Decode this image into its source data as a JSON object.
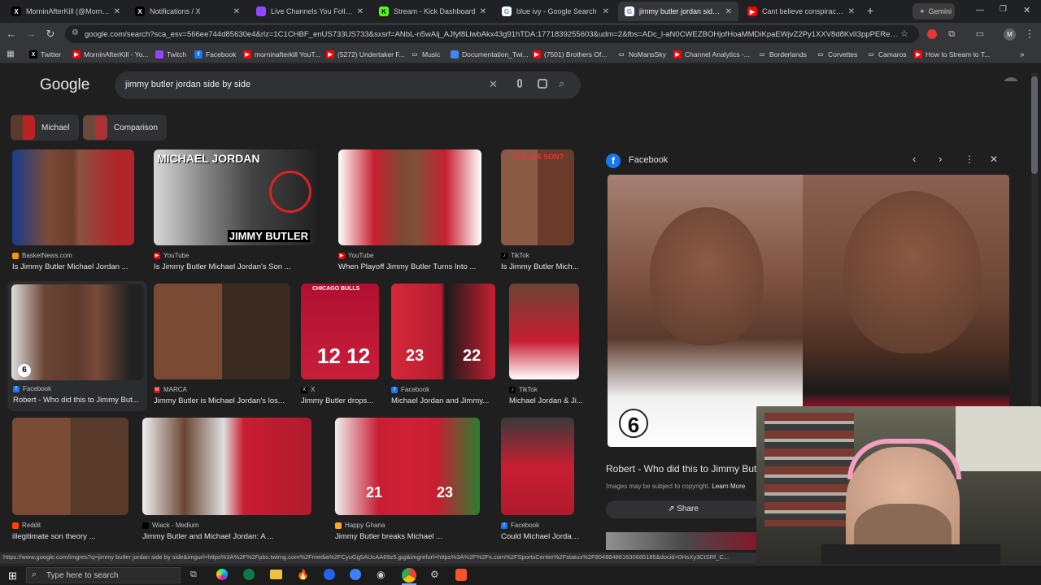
{
  "tabs": [
    {
      "label": "MorninAfterKill (@MorninAft...",
      "active": false
    },
    {
      "label": "Notifications / X",
      "active": false
    },
    {
      "label": "Live Channels You Follow - Tw",
      "active": false
    },
    {
      "label": "Stream - Kick Dashboard",
      "active": false
    },
    {
      "label": "blue ivy - Google Search",
      "active": false
    },
    {
      "label": "jimmy butler jordan side by s",
      "active": true
    },
    {
      "label": "Cant believe conspiracy Bill h",
      "active": false
    },
    {
      "label": "Gemini",
      "active": false
    }
  ],
  "new_tab_label": "+",
  "address": "google.com/search?sca_esv=566ee744d85630e4&rlz=1C1CHBF_enUS733US733&sxsrf=ANbL-n5wAlj_AJfyf8LlwbAkx43g91hTDA:1771839255603&udm=2&fbs=ADc_l-aN0CWEZBOHjofHoaMMDiKpaEWjvZ2Py1XXV8d8KvlI3ppPEReeCOS7s1V...",
  "bookmarks": [
    {
      "label": "Twitter",
      "icon": "x-icon"
    },
    {
      "label": "MorninAfterKill - Yo...",
      "icon": "youtube-icon"
    },
    {
      "label": "Twitch",
      "icon": "twitch-icon"
    },
    {
      "label": "Facebook",
      "icon": "facebook-icon"
    },
    {
      "label": "morninafterkill YouT...",
      "icon": "youtube-icon"
    },
    {
      "label": "(5272) Undertaker F...",
      "icon": "youtube-icon"
    },
    {
      "label": "Music",
      "icon": "folder-icon"
    },
    {
      "label": "Documentation_Twi...",
      "icon": "doc-icon"
    },
    {
      "label": "(7501) Brothers Of...",
      "icon": "youtube-icon"
    },
    {
      "label": "NoMansSky",
      "icon": "folder-icon"
    },
    {
      "label": "Channel Analytics -...",
      "icon": "youtube-icon"
    },
    {
      "label": "Borderlands",
      "icon": "folder-icon"
    },
    {
      "label": "Corvettes",
      "icon": "folder-icon"
    },
    {
      "label": "Camaros",
      "icon": "folder-icon"
    },
    {
      "label": "How to Stream to T...",
      "icon": "youtube-icon"
    }
  ],
  "google": {
    "logo": "Google",
    "query": "jimmy butler jordan side by side",
    "profile_initial": "M",
    "chips": [
      {
        "label": "Michael"
      },
      {
        "label": "Comparison"
      }
    ]
  },
  "results_row1": [
    {
      "source": "BasketNews.com",
      "caption": "Is Jimmy Butler Michael Jordan ..."
    },
    {
      "source": "YouTube",
      "caption": "Is Jimmy Butler Michael Jordan's Son ...",
      "overlay_top": "MICHAEL JORDAN",
      "overlay_bottom": "JIMMY BUTLER"
    },
    {
      "source": "YouTube",
      "caption": "When Playoff Jimmy Butler Turns Into ..."
    },
    {
      "source": "TikTok",
      "caption": "Is Jimmy Butler Mich...",
      "overlay_top": "IT'S HIS SON?"
    }
  ],
  "results_row2": [
    {
      "source": "Facebook",
      "caption": "Robert - Who did this to Jimmy But..."
    },
    {
      "source": "MARCA",
      "caption": "Jimmy Butler is Michael Jordan's los..."
    },
    {
      "source": "X",
      "caption": "Jimmy Butler drops...",
      "overlay_top": "CHICAGO BULLS"
    },
    {
      "source": "Facebook",
      "caption": "Michael Jordan and Jimmy..."
    },
    {
      "source": "TikTok",
      "caption": "Michael Jordan & Ji..."
    }
  ],
  "results_row3": [
    {
      "source": "Reddit",
      "caption": "illegitimate son theory ..."
    },
    {
      "source": "Wiack - Medium",
      "caption": "Jimmy Butler and Michael Jordan: A ..."
    },
    {
      "source": "Happy Ghana",
      "caption": "Jimmy Butler breaks Michael ..."
    },
    {
      "source": "Facebook",
      "caption": "Could Michael Jordan ..."
    }
  ],
  "panel": {
    "source": "Facebook",
    "title": "Robert - Who did this to Jimmy Butl",
    "copyright": "Images may be subject to copyright.",
    "learn_more": "Learn More",
    "share": "Share",
    "jersey_number": "6"
  },
  "status_url": "https://www.google.com/imgres?q=jimmy butler jordan side by side&imgurl=https%3A%2F%2Fpbs.twimg.com%2Fmedia%2FCyuGg5AUcAA69z5.jpg&imgrefurl=https%3A%2F%2Fx.com%2FSportsCenter%2Fstatus%2F804884861630685185&docid=0HsXy3CtSRf_C...",
  "taskbar": {
    "search_placeholder": "Type here to search"
  }
}
